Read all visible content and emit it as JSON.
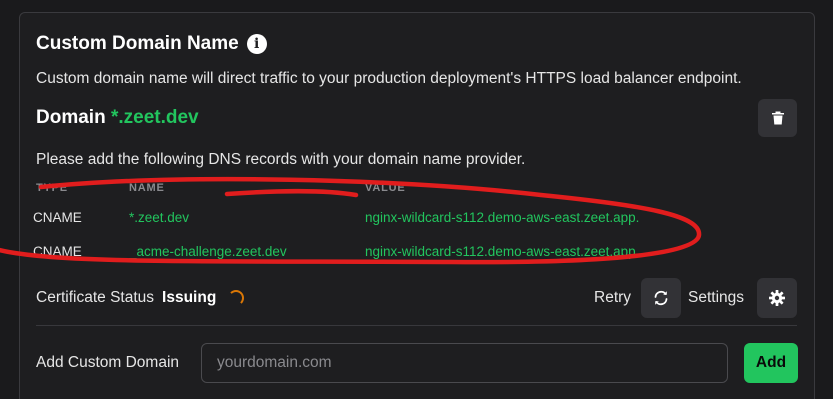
{
  "section": {
    "title": "Custom Domain Name",
    "info_icon": "info-icon",
    "description": "Custom domain name will direct traffic to your production deployment's HTTPS load balancer endpoint."
  },
  "domain": {
    "label": "Domain",
    "value": "*.zeet.dev",
    "delete_icon": "trash-icon"
  },
  "dns": {
    "instructions": "Please add the following DNS records with your domain name provider.",
    "columns": [
      "TYPE",
      "NAME",
      "VALUE"
    ],
    "rows": [
      {
        "type": "CNAME",
        "name": "*.zeet.dev",
        "value": "nginx-wildcard-s112.demo-aws-east.zeet.app."
      },
      {
        "type": "CNAME",
        "name": "_acme-challenge.zeet.dev",
        "value": "nginx-wildcard-s112.demo-aws-east.zeet.app"
      }
    ]
  },
  "certificate": {
    "label": "Certificate Status",
    "status": "Issuing",
    "retry_label": "Retry",
    "retry_icon": "refresh-icon",
    "settings_label": "Settings",
    "settings_icon": "gear-icon"
  },
  "add_domain": {
    "label": "Add Custom Domain",
    "placeholder": "yourdomain.com",
    "value": "",
    "button_label": "Add"
  },
  "colors": {
    "accent": "#22c55e",
    "background": "#1e1e20",
    "annotation": "#e11d1d",
    "spinner": "#d97706"
  }
}
